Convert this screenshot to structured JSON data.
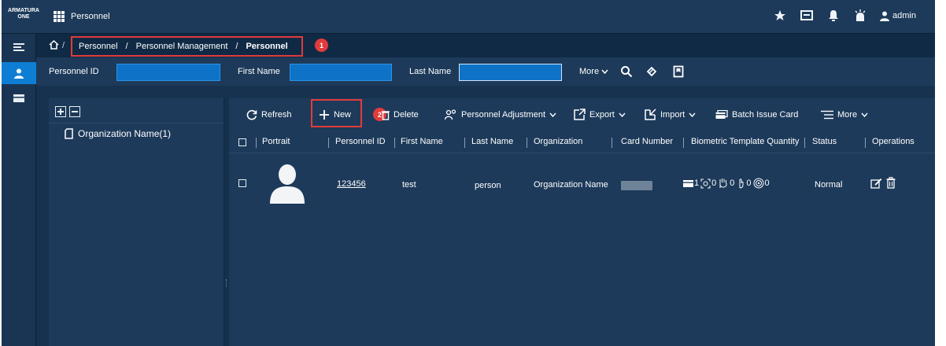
{
  "app": {
    "brand": "ARMATURA ONE",
    "title": "Personnel",
    "user": "admin"
  },
  "breadcrumb": {
    "items": [
      "Personnel",
      "Personnel Management",
      "Personnel"
    ],
    "separator": "/",
    "badge": "1"
  },
  "search": {
    "personnel_id_label": "Personnel ID",
    "personnel_id_value": "",
    "first_name_label": "First Name",
    "first_name_value": "",
    "last_name_label": "Last Name",
    "last_name_value": "",
    "more_label": "More"
  },
  "org": {
    "node_label": "Organization Name(1)"
  },
  "toolbar": {
    "refresh": "Refresh",
    "new": "New",
    "new_badge": "2",
    "delete": "Delete",
    "personnel_adjustment": "Personnel Adjustment",
    "export": "Export",
    "import": "Import",
    "batch_issue_card": "Batch Issue Card",
    "more": "More"
  },
  "table": {
    "columns": [
      "Portrait",
      "Personnel ID",
      "First Name",
      "Last Name",
      "Organization",
      "Card Number",
      "Biometric Template Quantity",
      "Status",
      "Operations"
    ],
    "rows": [
      {
        "personnel_id": "123456",
        "first_name": "test",
        "last_name": "person",
        "organization": "Organization Name",
        "biometric": [
          "1",
          "0",
          "0",
          "0",
          "0"
        ],
        "status": "Normal"
      }
    ]
  },
  "colors": {
    "accent": "#0e7ed4",
    "highlight": "#e23b3b",
    "panel": "#1d3a5a"
  }
}
